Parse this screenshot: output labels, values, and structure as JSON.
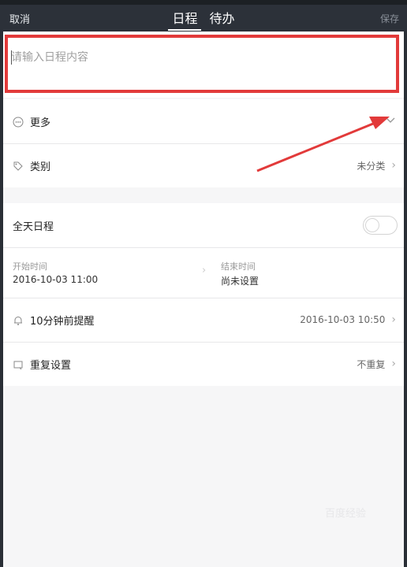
{
  "header": {
    "cancel_label": "取消",
    "save_label": "保存",
    "tabs": [
      {
        "label": "日程",
        "active": true
      },
      {
        "label": "待办",
        "active": false
      }
    ]
  },
  "input": {
    "placeholder": "请输入日程内容",
    "value": ""
  },
  "rows": {
    "more": {
      "label": "更多",
      "icon": "ellipsis-circle-icon",
      "trailing_icon": "chevron-down-icon"
    },
    "category": {
      "label": "类别",
      "value": "未分类",
      "icon": "tag-icon"
    },
    "all_day": {
      "label": "全天日程",
      "enabled": false
    },
    "start_time": {
      "label": "开始时间",
      "value": "2016-10-03 11:00"
    },
    "end_time": {
      "label": "结束时间",
      "value": "尚未设置"
    },
    "reminder": {
      "label": "10分钟前提醒",
      "value": "2016-10-03 10:50",
      "icon": "bell-icon"
    },
    "repeat": {
      "label": "重复设置",
      "value": "不重复",
      "icon": "repeat-icon"
    }
  },
  "annotation": {
    "highlight_color": "#e23a3a"
  },
  "watermark": "百度经验"
}
